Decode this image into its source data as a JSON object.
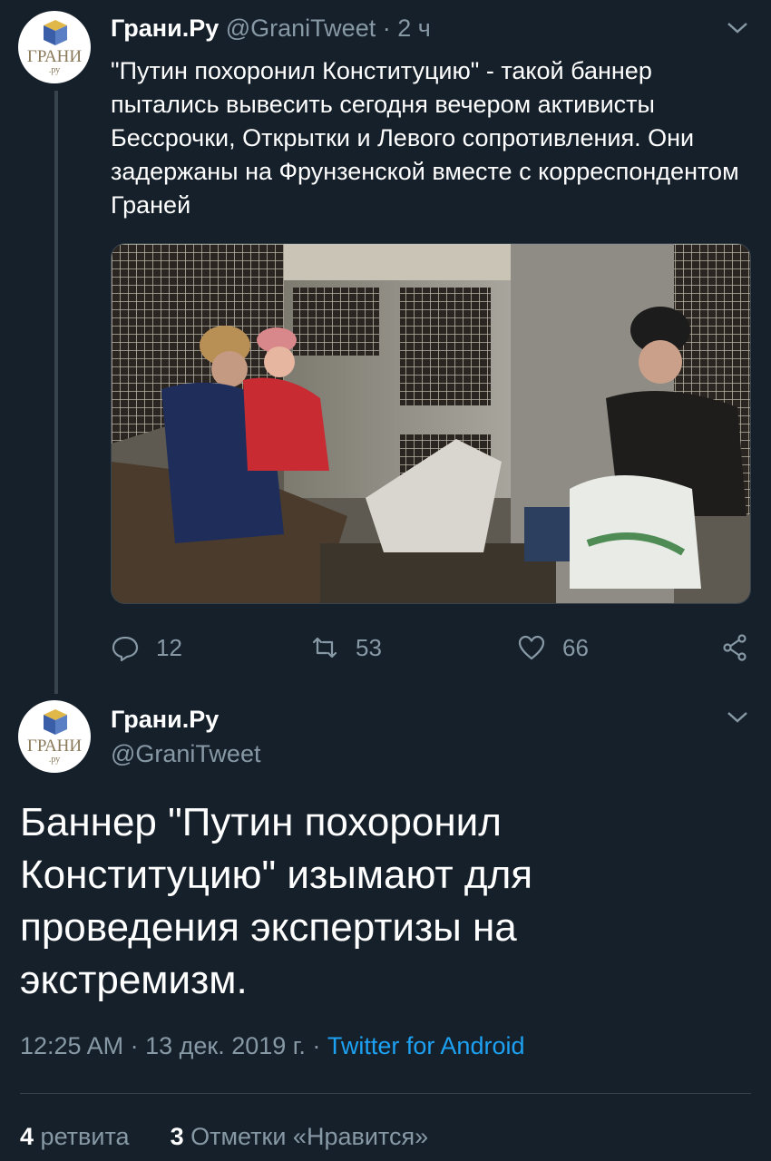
{
  "tweet1": {
    "avatar_text": "ГРАНИ",
    "avatar_sub": ".ру",
    "name": "Грани.Ру",
    "handle": "@GraniTweet",
    "separator": "·",
    "time": "2 ч",
    "text": "\"Путин похоронил Конституцию\" - такой баннер пытались вывесить сегодня вечером активисты Бессрочки, Открытки и Левого сопротивления. Они задержаны на Фрунзенской вместе с корреспондентом Граней",
    "actions": {
      "replies": "12",
      "retweets": "53",
      "likes": "66"
    }
  },
  "tweet2": {
    "avatar_text": "ГРАНИ",
    "avatar_sub": ".ру",
    "name": "Грани.Ру",
    "handle": "@GraniTweet",
    "text": "Баннер \"Путин похоронил Конституцию\" изымают для проведения экспертизы на экстремизм.",
    "time": "12:25 AM",
    "date": "13 дек. 2019 г.",
    "separator": "·",
    "source": "Twitter for Android",
    "retweet_count": "4",
    "retweet_label": "ретвита",
    "like_count": "3",
    "like_label": "Отметки «Нравится»"
  },
  "colors": {
    "background": "#15202b",
    "muted": "#8899a6",
    "link": "#1da1f2",
    "divider": "#38444d"
  },
  "icons": [
    "avatar-cube-icon",
    "chevron-down-icon",
    "reply-icon",
    "retweet-icon",
    "heart-icon",
    "share-icon"
  ]
}
